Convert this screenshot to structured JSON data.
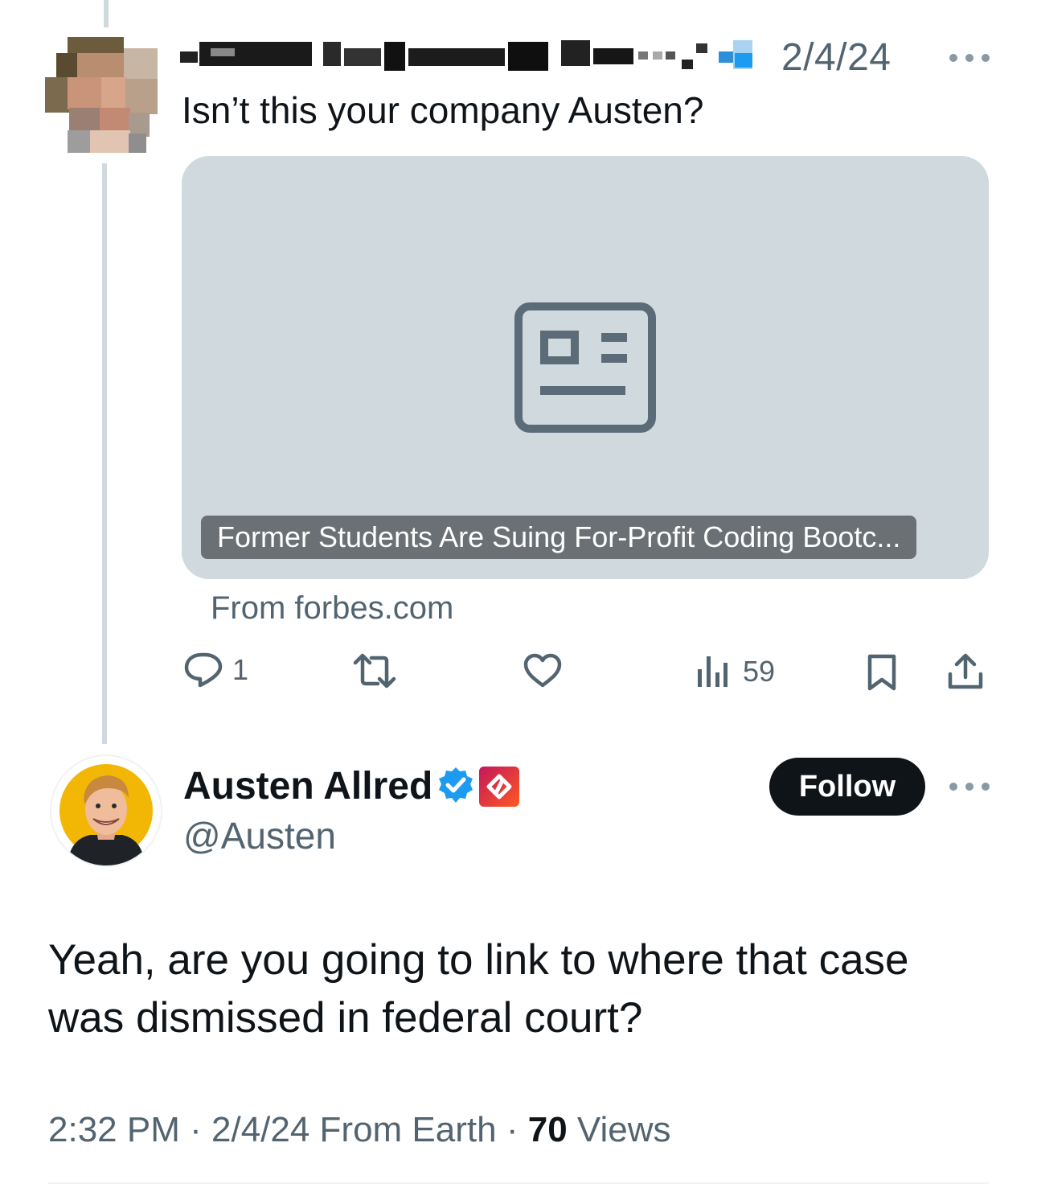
{
  "parent_tweet": {
    "author_name": "██████ ██ ███████ ████",
    "date": "2/4/24",
    "text": "Isn’t this your company Austen?",
    "card": {
      "headline": "Former Students Are Suing For-Profit Coding Bootc...",
      "source": "From forbes.com",
      "icon": "article-icon"
    },
    "actions": {
      "reply_count": "1",
      "retweet_count": "",
      "like_count": "",
      "view_count": "59"
    }
  },
  "reply_tweet": {
    "author_name": "Austen Allred",
    "handle": "@Austen",
    "follow_label": "Follow",
    "text": "Yeah, are you going to link to where that case was dismissed in federal court?",
    "meta": {
      "time": "2:32 PM",
      "sep1": "·",
      "date_location": "2/4/24 From Earth",
      "sep2": "·",
      "views_count": "70",
      "views_label": "Views"
    }
  },
  "colors": {
    "text_primary": "#0f1419",
    "text_secondary": "#536471",
    "verified_blue": "#1d9bf0",
    "card_bg": "#cfd9de"
  }
}
